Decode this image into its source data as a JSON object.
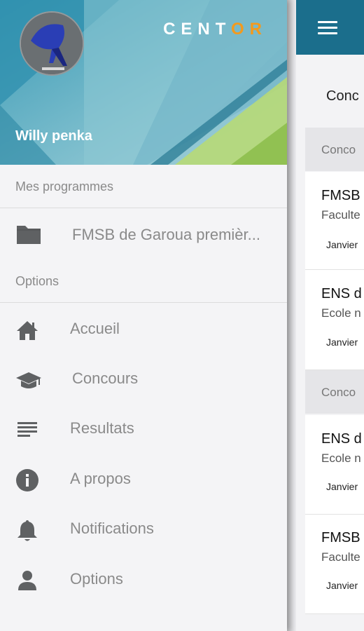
{
  "background": {
    "title": "Conc",
    "sections": [
      {
        "label": "Conco",
        "cards": [
          {
            "title": "FMSB",
            "subtitle": "Faculte",
            "date": "Janvier"
          },
          {
            "title": "ENS d",
            "subtitle": "Ecole n",
            "date": "Janvier"
          }
        ]
      },
      {
        "label": "Conco",
        "cards": [
          {
            "title": "ENS d",
            "subtitle": "Ecole n",
            "date": "Janvier"
          },
          {
            "title": "FMSB",
            "subtitle": "Faculte",
            "date": "Janvier"
          }
        ]
      }
    ]
  },
  "drawer": {
    "brand_main": "CENT",
    "brand_accent": "OR",
    "user_name": "Willy penka",
    "programs_header": "Mes programmes",
    "programs": [
      {
        "icon": "folder-icon",
        "label": "FMSB de Garoua premièr..."
      }
    ],
    "options_header": "Options",
    "items": [
      {
        "icon": "home-icon",
        "label": "Accueil"
      },
      {
        "icon": "graduation-cap-icon",
        "label": "Concours"
      },
      {
        "icon": "list-icon",
        "label": "Resultats"
      },
      {
        "icon": "info-icon",
        "label": "A propos"
      },
      {
        "icon": "bell-icon",
        "label": "Notifications"
      },
      {
        "icon": "person-icon",
        "label": "Options"
      }
    ]
  },
  "colors": {
    "toolbar": "#1b6e8c",
    "brand_accent": "#f39a1d",
    "icon": "#5f6163",
    "label": "#8a8a8a"
  }
}
